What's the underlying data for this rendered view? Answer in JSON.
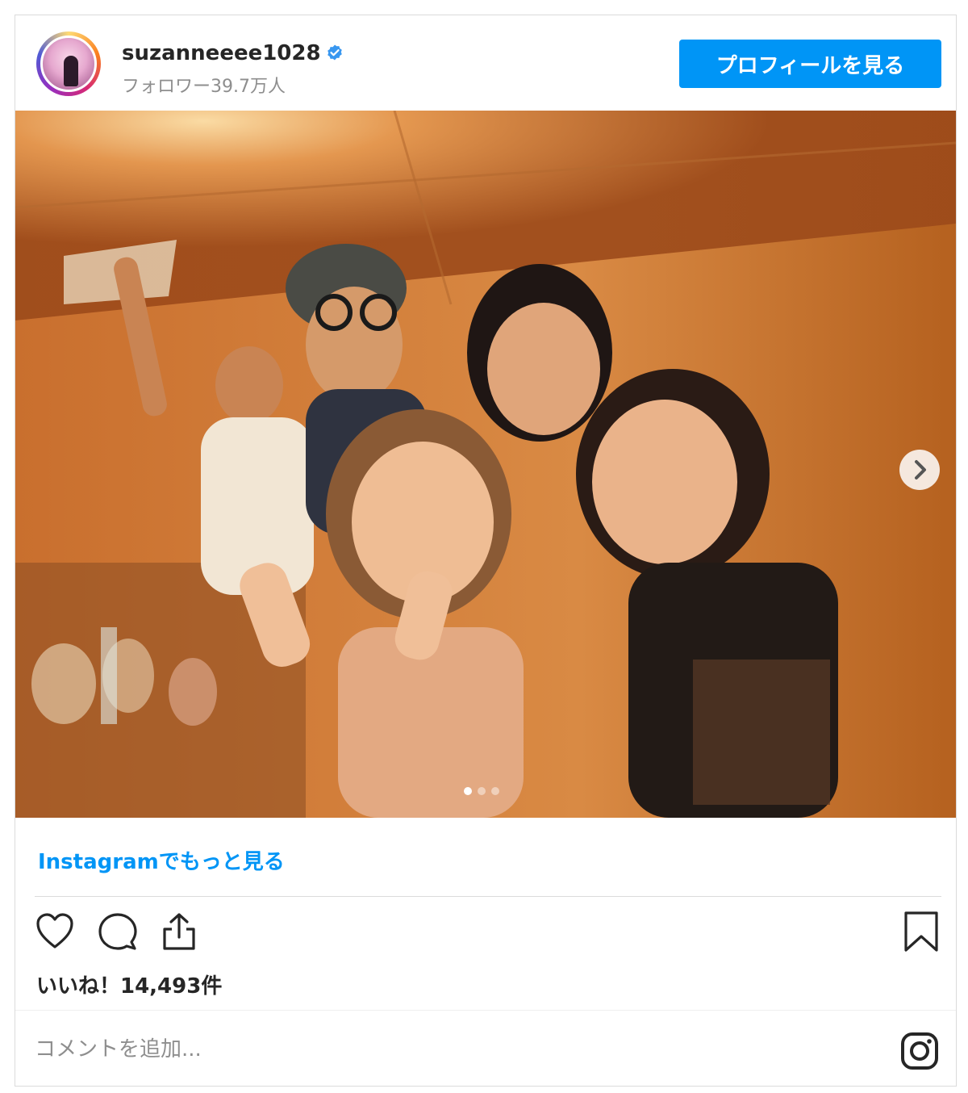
{
  "header": {
    "username": "suzanneeee1028",
    "followers": "フォロワー39.7万人",
    "profile_button": "プロフィールを見る"
  },
  "post": {
    "carousel_pages": 3,
    "carousel_active": 1
  },
  "more_link": "Instagramでもっと見る",
  "likes": "いいね！14,493件",
  "comment": {
    "placeholder": "コメントを追加..."
  },
  "icons": [
    "verified-badge-icon",
    "heart-icon",
    "comment-icon",
    "share-icon",
    "bookmark-icon",
    "instagram-icon",
    "chevron-right-icon"
  ],
  "colors": {
    "accent": "#0095f6",
    "text": "#262626",
    "muted": "#8e8e8e"
  }
}
